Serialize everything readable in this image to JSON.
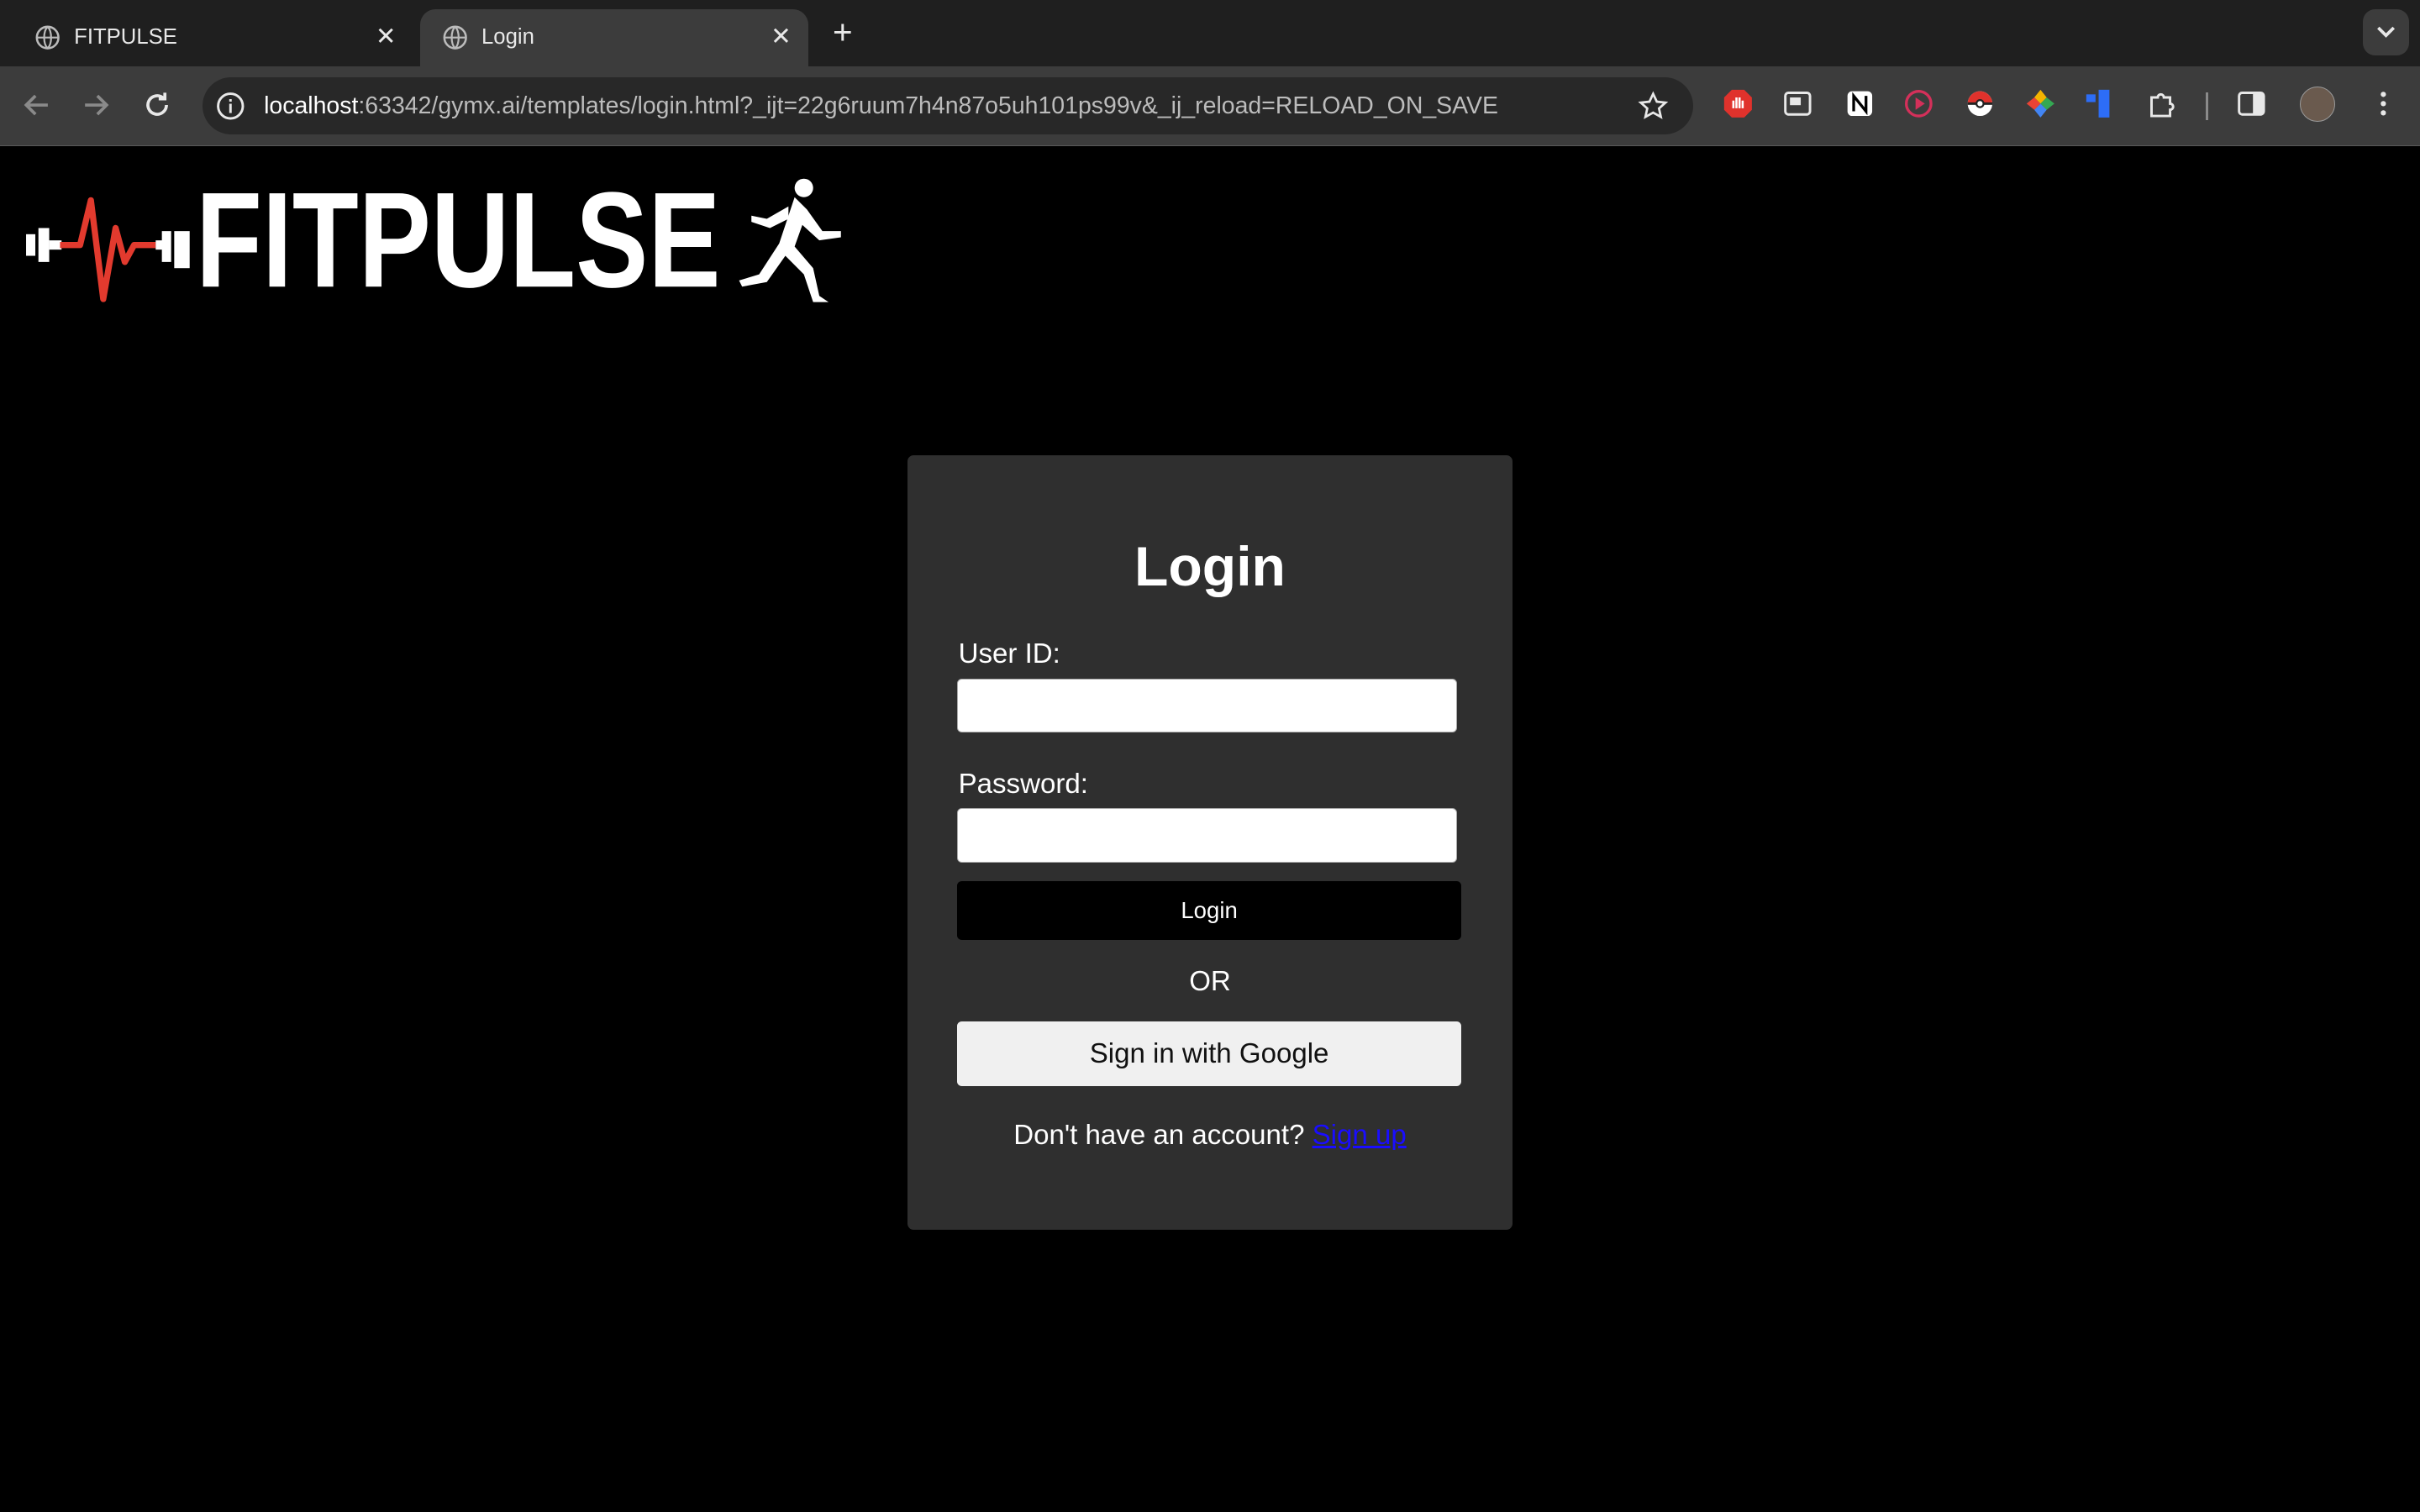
{
  "browser": {
    "tabs": [
      {
        "title": "FITPULSE",
        "icon": "globe-icon",
        "active": false
      },
      {
        "title": "Login",
        "icon": "globe-icon",
        "active": true
      }
    ],
    "url_host": "localhost",
    "url_rest": ":63342/gymx.ai/templates/login.html?_ijt=22g6ruum7h4n87o5uh101ps99v&_ij_reload=RELOAD_ON_SAVE",
    "extensions": [
      "adblock-icon",
      "picture-in-picture-icon",
      "notion-icon",
      "video-extension-icon",
      "pokeball-icon",
      "color-wheel-icon",
      "blue-extension-icon",
      "puzzle-icon"
    ],
    "colors": {
      "chrome_dark": "#1f1f1f",
      "toolbar": "#3c3c3c",
      "omnibox": "#282828"
    }
  },
  "logo": {
    "text": "FITPULSE",
    "accent_color": "#e23a2e"
  },
  "login_form": {
    "title": "Login",
    "user_id_label": "User ID:",
    "user_id_value": "",
    "password_label": "Password:",
    "password_value": "",
    "login_button": "Login",
    "or_text": "OR",
    "google_button": "Sign in with Google",
    "signup_prompt": "Don't have an account?",
    "signup_link": "Sign up",
    "colors": {
      "card_bg": "#2f2f2f",
      "page_bg": "#000000",
      "link": "#1a0dff"
    }
  }
}
